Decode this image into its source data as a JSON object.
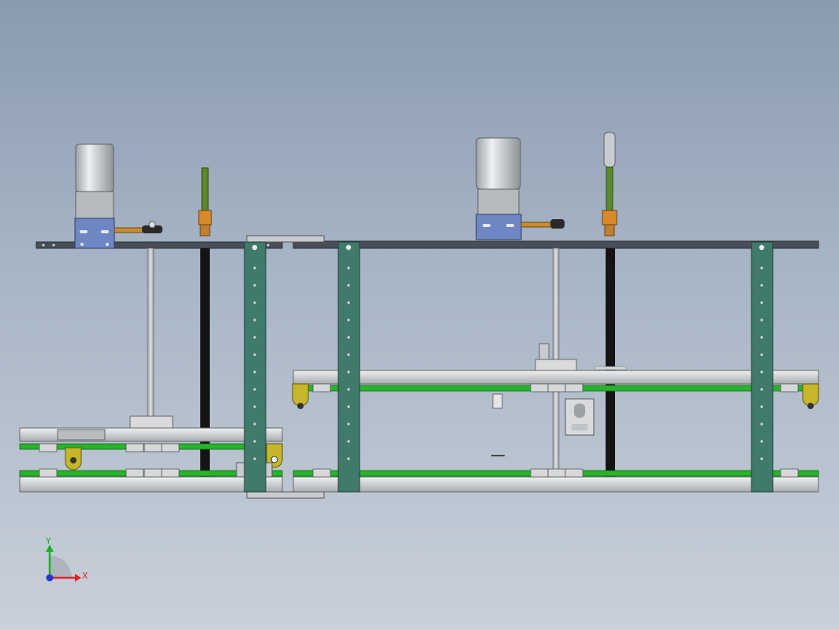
{
  "view": {
    "background_top": "#8a9bb0",
    "background_bottom": "#c8d0da"
  },
  "triad": {
    "x_label": "X",
    "y_label": "Y",
    "x_color": "#e0242a",
    "y_color": "#19b21e",
    "z_color": "#2a36c8"
  },
  "colors": {
    "frame_post": "#3f7a6a",
    "top_beam": "#4a4e58",
    "green_belt": "#27b42a",
    "motor_body": "#c4c6c8",
    "motor_mount": "#6f86c4",
    "orange_arm": "#c98b2e",
    "yellow_bracket": "#c6b72a",
    "lead_screw": "#1a1a1a",
    "rail": "#d5d8db"
  }
}
